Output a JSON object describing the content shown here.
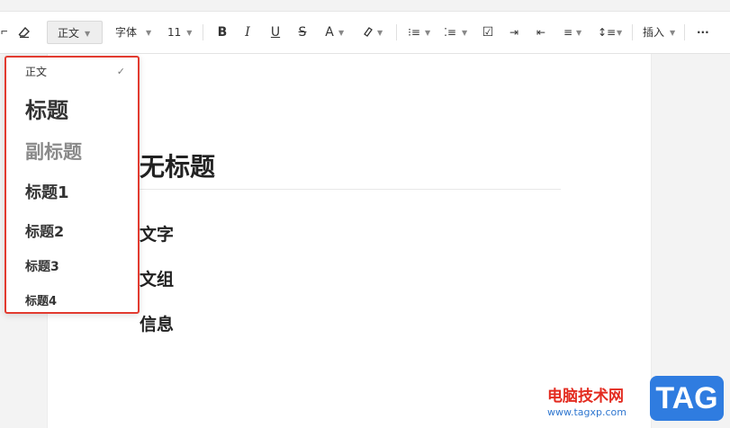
{
  "toolbar": {
    "style_value": "正文",
    "font_value": "字体",
    "size_value": "11",
    "bold": "B",
    "italic": "I",
    "underline": "U",
    "strike": "S",
    "text_color": "A",
    "insert_label": "插入",
    "more": "···"
  },
  "style_menu": {
    "items": [
      {
        "label": "正文",
        "checked": true
      },
      {
        "label": "标题",
        "checked": false
      },
      {
        "label": "副标题",
        "checked": false
      },
      {
        "label": "标题1",
        "checked": false
      },
      {
        "label": "标题2",
        "checked": false
      },
      {
        "label": "标题3",
        "checked": false
      },
      {
        "label": "标题4",
        "checked": false
      }
    ],
    "check_mark": "✓"
  },
  "document": {
    "title": "无标题",
    "lines": [
      "文字",
      "文组",
      "信息"
    ]
  },
  "watermark": {
    "text": "电脑技术网",
    "url": "www.tagxp.com",
    "badge": "TAG"
  },
  "colors": {
    "highlight_border": "#e23b30",
    "watermark_red": "#e32b20",
    "watermark_blue": "#2f7ce0"
  }
}
